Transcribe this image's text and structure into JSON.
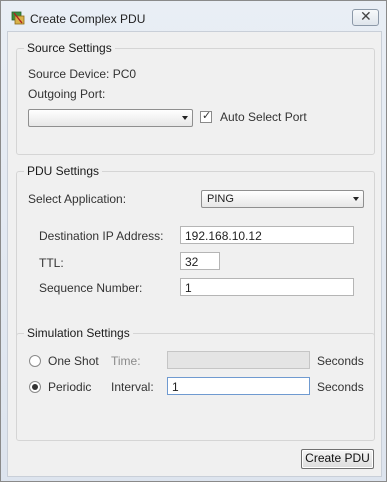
{
  "window": {
    "title": "Create Complex PDU"
  },
  "source_settings": {
    "legend": "Source Settings",
    "source_device_label": "Source Device: PC0",
    "outgoing_port_label": "Outgoing Port:",
    "outgoing_port_value": "",
    "auto_select_label": "Auto Select Port",
    "auto_select_checked": true
  },
  "pdu_settings": {
    "legend": "PDU Settings",
    "select_application_label": "Select Application:",
    "application_value": "PING",
    "destination_ip_label": "Destination IP Address:",
    "destination_ip_value": "192.168.10.12",
    "ttl_label": "TTL:",
    "ttl_value": "32",
    "sequence_label": "Sequence Number:",
    "sequence_value": "1"
  },
  "simulation_settings": {
    "legend": "Simulation Settings",
    "one_shot_label": "One Shot",
    "time_label": "Time:",
    "time_value": "",
    "periodic_label": "Periodic",
    "interval_label": "Interval:",
    "interval_value": "1",
    "seconds_label": "Seconds",
    "mode": "periodic"
  },
  "actions": {
    "create_label": "Create PDU"
  }
}
